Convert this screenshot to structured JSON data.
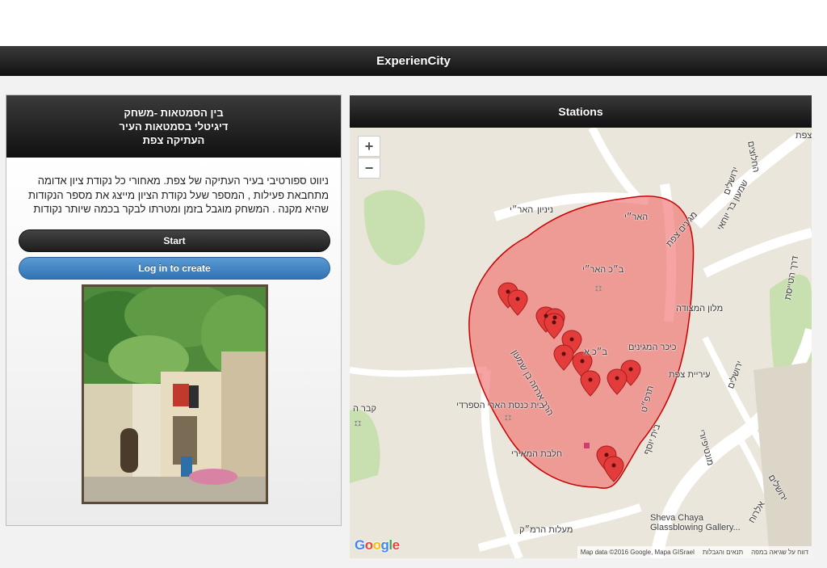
{
  "app": {
    "title": "ExperienCity"
  },
  "game_panel": {
    "title_lines": [
      "בין הסמטאות -משחק",
      "דיגיטלי בסמטאות העיר",
      "העתיקה צפת"
    ],
    "description": "ניווט ספורטיבי בעיר העתיקה של צפת. מאחורי כל נקודת ציון אדומה מתחבאת פעילות , המספר שעל נקודת הציון מייצג את מספר הנקודות שהיא מקנה . המשחק מוגבל בזמן ומטרתו לבקר בכמה שיותר נקודות",
    "start_label": "Start",
    "login_label": "Log in to create"
  },
  "stations_panel": {
    "title": "Stations",
    "zoom_in": "+",
    "zoom_out": "−",
    "google_logo": "Google",
    "attribution": {
      "map_data": "Map data ©2016 Google, Mapa GISrael",
      "terms": "תנאים והגבלות",
      "report": "דווח על שגיאה במפה"
    },
    "labels": {
      "haari": "האר״י",
      "haari2": "האר״י",
      "nenin": "ניניון",
      "bichaari": "ב״כ האר״י",
      "kikar": "כיכר המגינים",
      "bichavm": "ב״כ א",
      "beitknesset": "בית כנסת הארי הספרדי",
      "chalavat": "חלבת המאירי",
      "hadyah": "הרב ארחה בן שמעון",
      "malon": "מלון המצודה",
      "shimon": "שמעון בר יוחאי",
      "yerushalayim": "ירושלים",
      "yerushalayim2": "ירושלים",
      "yerushalayim3": "ירושלים",
      "irbit": "עיריית צפת",
      "sheva": "Sheva Chaya",
      "glass": "Glassblowing Gallery...",
      "maalot": "מעלות הרמ״ק",
      "kever": "קבר ה",
      "montefiore": "מונטיפיורי",
      "elchoro": "אלרוח",
      "derech": "דרך הטייסת",
      "beitsef": "בית יוסף",
      "safed": "צפת",
      "chalutzim": "החלוצים",
      "tzfat2": "תרפ״ט",
      "mitzpe": "מגינים צפת"
    }
  },
  "colors": {
    "header_dark": "#111111",
    "login_blue": "#3a7fc1",
    "polygon_fill": "#f06b6b",
    "polygon_stroke": "#c80000",
    "marker": "#e43b3b"
  },
  "icons": [
    "zoom-in-icon",
    "zoom-out-icon",
    "map-marker-icon",
    "synagogue-icon",
    "museum-icon"
  ]
}
